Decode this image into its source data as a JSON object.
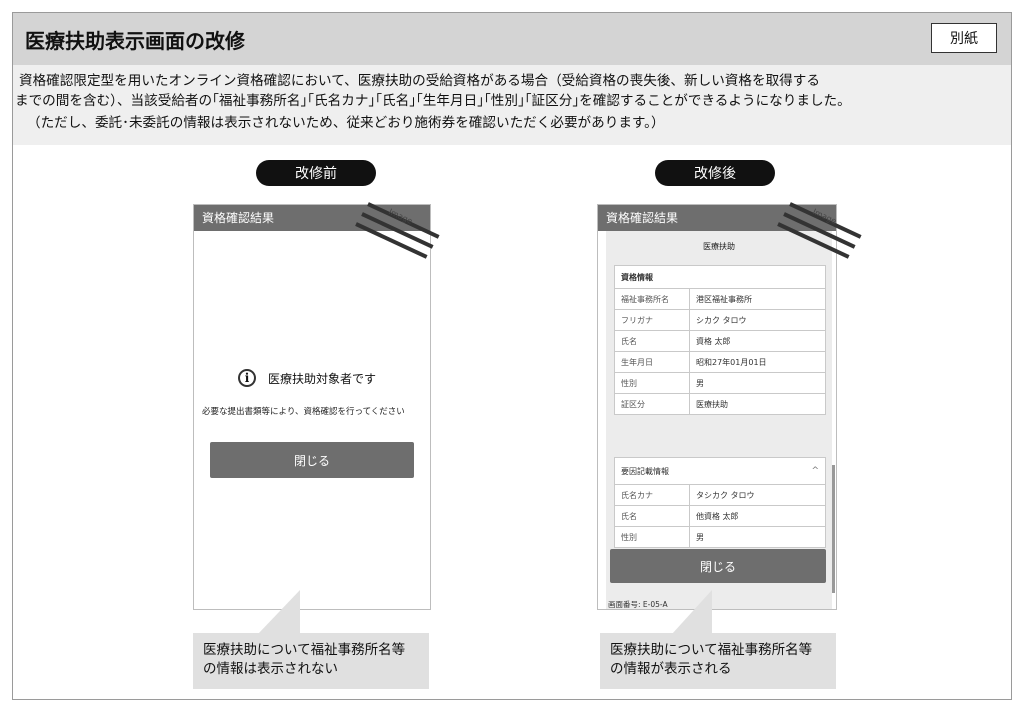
{
  "header": {
    "title": "医療扶助表示画面の改修",
    "attachment_label": "別紙"
  },
  "description": {
    "line1": "資格確認限定型を用いたオンライン資格確認において、医療扶助の受給資格がある場合（受給資格の喪失後、新しい資格を取得する",
    "line2": "までの間を含む）、当該受給者の｢福祉事務所名｣｢氏名カナ｣｢氏名｣｢生年月日｣｢性別｣｢証区分｣を確認することができるようになりました。",
    "line3": "（ただし、委託･未委託の情報は表示されないため、従来どおり施術券を確認いただく必要があります。）"
  },
  "before": {
    "pill_label": "改修前",
    "screen_title": "資格確認結果",
    "image_label": "Image",
    "info_icon": "info-circle-icon",
    "info_text": "医療扶助対象者です",
    "note": "必要な提出書類等により、資格確認を行ってください",
    "close_label": "閉じる",
    "caption_line1": "医療扶助について福祉事務所名等",
    "caption_line2": "の情報は表示されない"
  },
  "after": {
    "pill_label": "改修後",
    "screen_title": "資格確認結果",
    "image_label": "Image",
    "section_title": "医療扶助",
    "qualification_header": "資格情報",
    "qualification_rows": [
      {
        "key": "福祉事務所名",
        "value": "港区福祉事務所"
      },
      {
        "key": "フリガナ",
        "value": "シカク タロウ"
      },
      {
        "key": "氏名",
        "value": "資格 太郎"
      },
      {
        "key": "生年月日",
        "value": "昭和27年01月01日"
      },
      {
        "key": "性別",
        "value": "男"
      },
      {
        "key": "証区分",
        "value": "医療扶助"
      }
    ],
    "notes_header": "要因記載情報",
    "chevron_icon": "chevron-up-icon",
    "notes_rows": [
      {
        "key": "氏名カナ",
        "value": "タシカク タロウ"
      },
      {
        "key": "氏名",
        "value": "他資格 太郎"
      },
      {
        "key": "性別",
        "value": "男"
      }
    ],
    "close_label": "閉じる",
    "screen_number": "画面番号: E-05-A",
    "caption_line1": "医療扶助について福祉事務所名等",
    "caption_line2": "の情報が表示される"
  }
}
